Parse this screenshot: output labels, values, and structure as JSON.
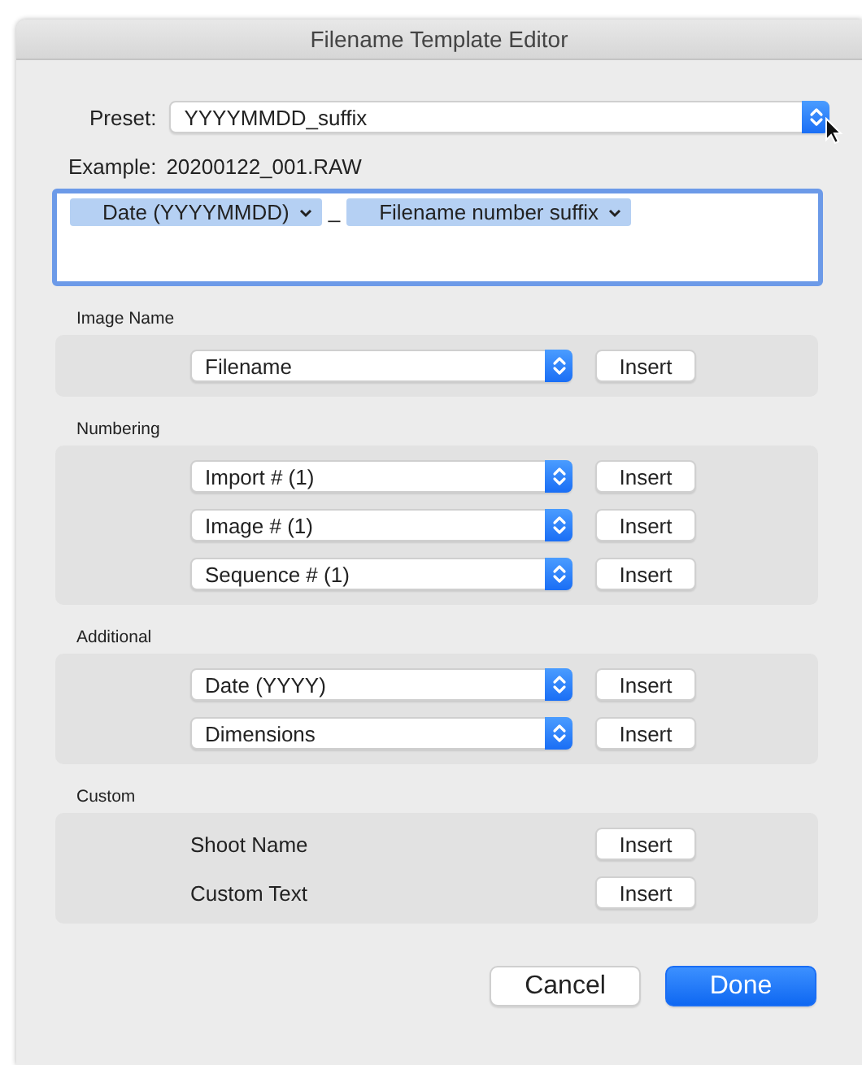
{
  "window": {
    "title": "Filename Template Editor"
  },
  "preset": {
    "label": "Preset:",
    "value": "YYYYMMDD_suffix"
  },
  "example": {
    "label": "Example:",
    "value": "20200122_001.RAW"
  },
  "template": [
    {
      "kind": "token",
      "label": "Date (YYYYMMDD)"
    },
    {
      "kind": "separator",
      "label": "_"
    },
    {
      "kind": "token",
      "label": "Filename number suffix"
    }
  ],
  "sections": [
    {
      "title": "Image Name",
      "rows": [
        {
          "kind": "select",
          "label": "Filename",
          "button": "Insert"
        }
      ]
    },
    {
      "title": "Numbering",
      "rows": [
        {
          "kind": "select",
          "label": "Import # (1)",
          "button": "Insert"
        },
        {
          "kind": "select",
          "label": "Image # (1)",
          "button": "Insert"
        },
        {
          "kind": "select",
          "label": "Sequence # (1)",
          "button": "Insert"
        }
      ]
    },
    {
      "title": "Additional",
      "rows": [
        {
          "kind": "select",
          "label": "Date (YYYY)",
          "button": "Insert"
        },
        {
          "kind": "select",
          "label": "Dimensions",
          "button": "Insert"
        }
      ]
    },
    {
      "title": "Custom",
      "rows": [
        {
          "kind": "text",
          "label": "Shoot Name",
          "button": "Insert"
        },
        {
          "kind": "text",
          "label": "Custom Text",
          "button": "Insert"
        }
      ]
    }
  ],
  "buttons": [
    {
      "label": "Cancel",
      "kind": "normal"
    },
    {
      "label": "Done",
      "kind": "default"
    }
  ]
}
